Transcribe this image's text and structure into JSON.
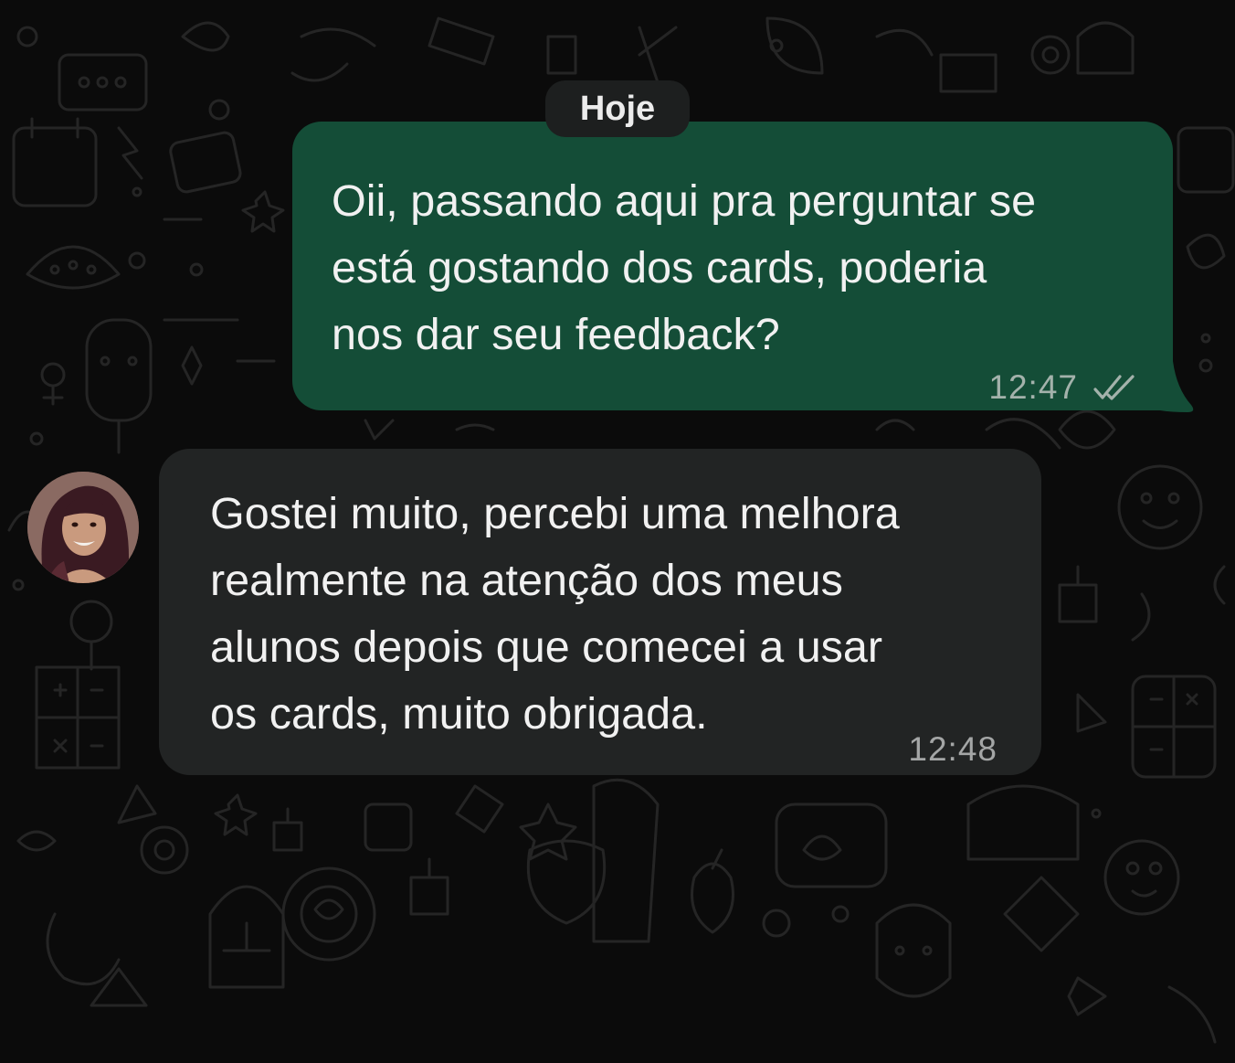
{
  "chat": {
    "date_separator": "Hoje",
    "messages": [
      {
        "direction": "outgoing",
        "text": "Oii, passando aqui pra perguntar se\nestá gostando dos cards, poderia\nnos dar seu feedback?",
        "time": "12:47",
        "status_icon": "double-check-icon"
      },
      {
        "direction": "incoming",
        "text": "Gostei muito, percebi uma melhora\nrealmente na atenção dos meus\nalunos depois que comecei a usar\nos cards, muito obrigada.",
        "time": "12:48",
        "avatar_icon": "contact-avatar"
      }
    ]
  },
  "colors": {
    "background": "#0b0b0b",
    "outgoing_bubble": "#144d37",
    "incoming_bubble": "#222424",
    "date_chip": "#1d1f1f",
    "text": "#f1f1f1",
    "meta_text": "#a3b2ab"
  }
}
